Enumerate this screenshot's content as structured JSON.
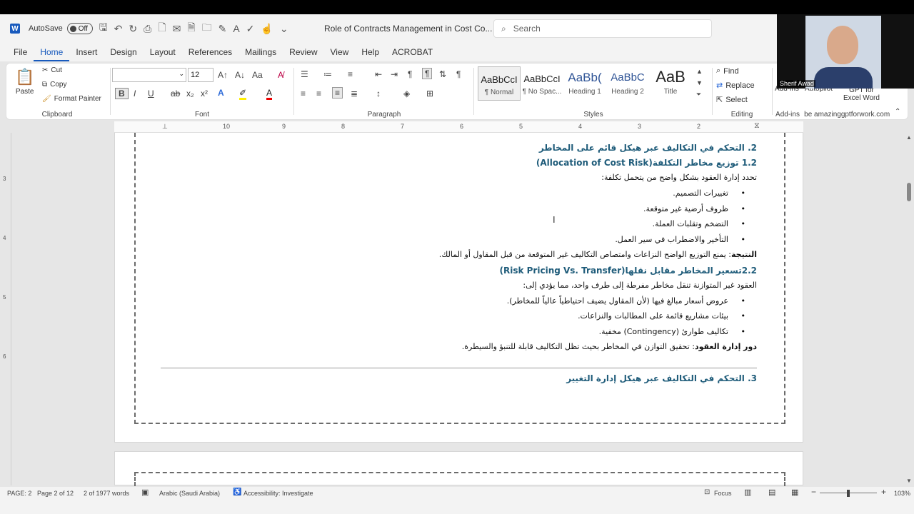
{
  "qat": {
    "app_icon": "word-icon",
    "autosave_label": "AutoSave",
    "autosave_state": "Off",
    "document_title": "Role of Contracts Management in Cost Co...",
    "search_placeholder": "Search"
  },
  "tabs": [
    "File",
    "Home",
    "Insert",
    "Design",
    "Layout",
    "References",
    "Mailings",
    "Review",
    "View",
    "Help",
    "ACROBAT"
  ],
  "ribbon": {
    "clipboard": {
      "paste": "Paste",
      "cut": "Cut",
      "copy": "Copy",
      "format_painter": "Format Painter",
      "label": "Clipboard"
    },
    "font": {
      "font_size": "12",
      "label": "Font",
      "bold": "B",
      "italic": "I",
      "underline": "U",
      "strike": "ab",
      "subscript": "x₂",
      "superscript": "x²",
      "case": "Aa"
    },
    "paragraph": {
      "label": "Paragraph"
    },
    "styles": {
      "label": "Styles",
      "items": [
        {
          "preview": "AaBbCcI",
          "name": "¶ Normal"
        },
        {
          "preview": "AaBbCcI",
          "name": "¶ No Spac..."
        },
        {
          "preview": "AaBb(",
          "name": "Heading 1"
        },
        {
          "preview": "AaBbC",
          "name": "Heading 2"
        },
        {
          "preview": "AaB",
          "name": "Title"
        }
      ]
    },
    "editing": {
      "find": "Find",
      "replace": "Replace",
      "select": "Select",
      "label": "Editing"
    },
    "addins": {
      "addins": "Add-ins",
      "label": "Add-ins",
      "autopilot": "Autopilot",
      "autopilot_sub": "be amazing",
      "gpt_line1": "GPT for",
      "gpt_line2": "Excel Word",
      "gpt_sub": "gptforwork.com"
    }
  },
  "video": {
    "participant_name": "Sherif Awad"
  },
  "ruler_numbers": [
    "10",
    "9",
    "8",
    "7",
    "6",
    "5",
    "4",
    "3",
    "2",
    "1"
  ],
  "vruler_numbers": [
    "3",
    "4",
    "5",
    "6"
  ],
  "document": {
    "heading_2": "2. التحكم في التكاليف عبر هيكل قائم على المخاطر",
    "heading_2_1": "1.2 توزيع مخاطر التكلفة(Allocation of Cost Risk)",
    "intro_2_1": "تحدد إدارة العقود بشكل واضح من يتحمل تكلفة:",
    "bullets_2_1": [
      "تغييرات التصميم.",
      "ظروف أرضية غير متوقعة.",
      "التضخم وتقلبات العملة.",
      "التأخير والاضطراب في سير العمل."
    ],
    "result_label": "النتيجة",
    "result_text": ": يمنع التوزيع الواضح النزاعات وامتصاص التكاليف غير المتوقعة من قبل المقاول أو المالك.",
    "heading_2_2": "2.2تسعير المخاطر مقابل نقلها(Risk Pricing Vs. Transfer)",
    "intro_2_2": "العقود غير المتوازنة تنقل مخاطر مفرطة إلى طرف واحد، مما يؤدي إلى:",
    "bullets_2_2": [
      "عروض أسعار مبالغ فيها (لأن المقاول يضيف احتياطياً عالياً للمخاطر).",
      "بيئات مشاريع قائمة على المطالبات والنزاعات.",
      "تكاليف طوارئ (Contingency) مخفية."
    ],
    "role_label": "دور إدارة العقود",
    "role_text": ": تحقيق التوازن في المخاطر بحيث تظل التكاليف قابلة للتنبؤ والسيطرة.",
    "heading_3": "3. التحكم في التكاليف عبر هيكل إدارة التغيير"
  },
  "status": {
    "page": "PAGE: 2",
    "page_of": "Page 2 of 12",
    "words": "2 of 1977 words",
    "language": "Arabic (Saudi Arabia)",
    "accessibility": "Accessibility: Investigate",
    "focus": "Focus",
    "zoom": "103%"
  }
}
